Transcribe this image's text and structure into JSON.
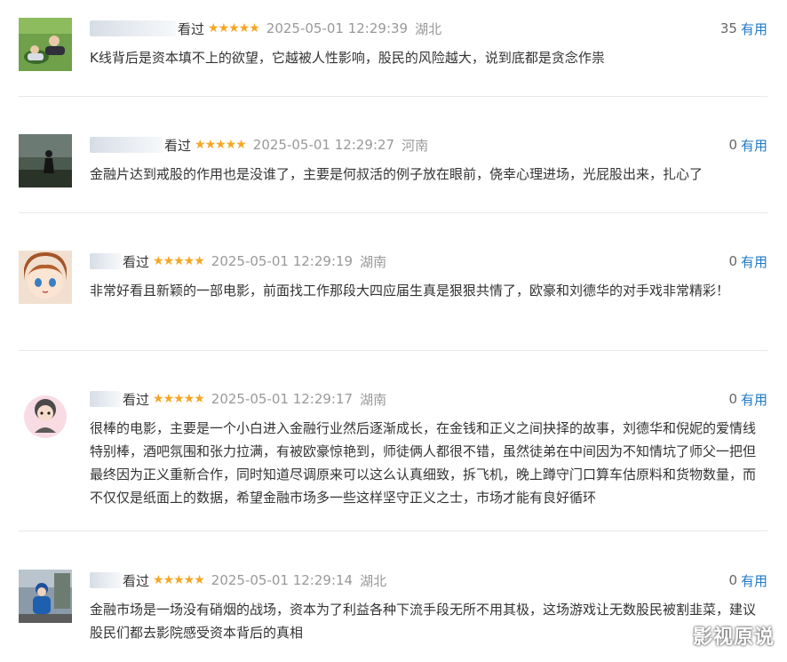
{
  "reviews": [
    {
      "watched": "看过",
      "stars": "★★★★★",
      "timestamp": "2025-05-01 12:29:39",
      "location": "湖北",
      "vote_count": "35",
      "useful_label": "有用",
      "comment": "K线背后是资本填不上的欲望，它越被人性影响，股民的风险越大，说到底都是贪念作祟"
    },
    {
      "watched": "看过",
      "stars": "★★★★★",
      "timestamp": "2025-05-01 12:29:27",
      "location": "河南",
      "vote_count": "0",
      "useful_label": "有用",
      "comment": "金融片达到戒股的作用也是没谁了，主要是何叔活的例子放在眼前，侥幸心理进场，光屁股出来，扎心了"
    },
    {
      "watched": "看过",
      "stars": "★★★★★",
      "timestamp": "2025-05-01 12:29:19",
      "location": "湖南",
      "vote_count": "0",
      "useful_label": "有用",
      "comment": "非常好看且新颖的一部电影，前面找工作那段大四应届生真是狠狠共情了，欧豪和刘德华的对手戏非常精彩！"
    },
    {
      "watched": "看过",
      "stars": "★★★★★",
      "timestamp": "2025-05-01 12:29:17",
      "location": "湖南",
      "vote_count": "0",
      "useful_label": "有用",
      "comment": "很棒的电影，主要是一个小白进入金融行业然后逐渐成长，在金钱和正义之间抉择的故事，刘德华和倪妮的爱情线特别棒，酒吧氛围和张力拉满，有被欧豪惊艳到，师徒俩人都很不错，虽然徒弟在中间因为不知情坑了师父一把但最终因为正义重新合作，同时知道尽调原来可以这么认真细致，拆飞机，晚上蹲守门口算车估原料和货物数量，而不仅仅是纸面上的数据，希望金融市场多一些这样坚守正义之士，市场才能有良好循环"
    },
    {
      "watched": "看过",
      "stars": "★★★★★",
      "timestamp": "2025-05-01 12:29:14",
      "location": "湖北",
      "vote_count": "0",
      "useful_label": "有用",
      "comment": "金融市场是一场没有硝烟的战场，资本为了利益各种下流手段无所不用其极，这场游戏让无数股民被割韭菜，建议股民们都去影院感受资本背后的真相"
    }
  ],
  "watermark": "影视原说",
  "colors": {
    "star": "#f5a623",
    "link": "#1f7ac4",
    "muted": "#999999",
    "divider": "#e8e8e8"
  }
}
